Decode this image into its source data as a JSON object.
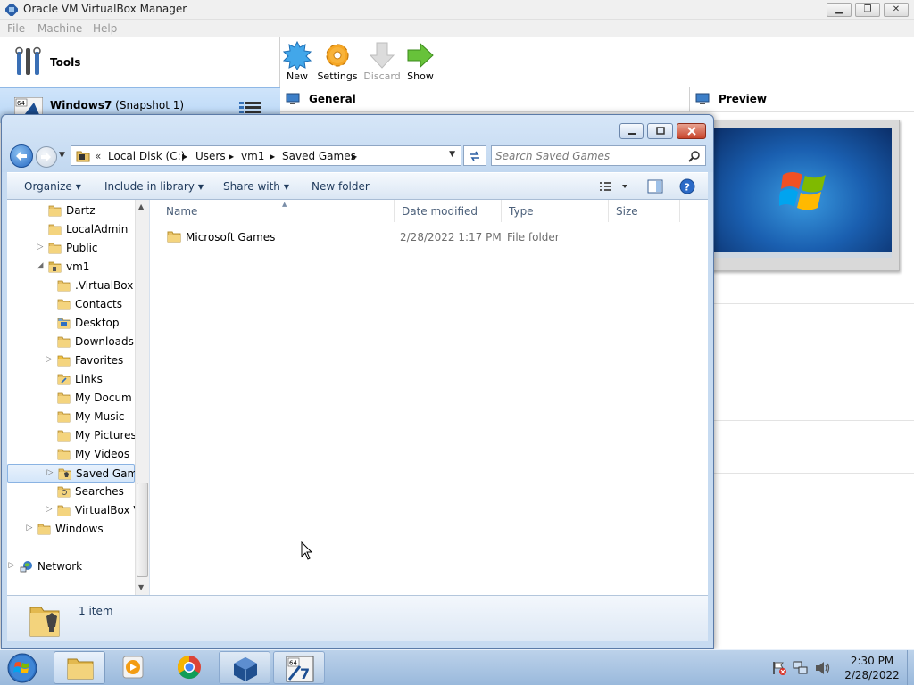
{
  "virtualbox": {
    "title": "Oracle VM VirtualBox Manager",
    "menu": [
      "File",
      "Machine",
      "Help"
    ],
    "tools_label": "Tools",
    "vm": {
      "name": "Windows7",
      "state": "(Snapshot 1)",
      "badge": "64"
    },
    "toolbar": {
      "new": "New",
      "settings": "Settings",
      "discard": "Discard",
      "show": "Show"
    },
    "sections": {
      "general": "General",
      "preview": "Preview"
    }
  },
  "explorer": {
    "breadcrumb": [
      "Local Disk (C:)",
      "Users",
      "vm1",
      "Saved Games"
    ],
    "breadcrumb_prefix": "«",
    "search_placeholder": "Search Saved Games",
    "commands": {
      "organize": "Organize",
      "include_in_library": "Include in library",
      "share_with": "Share with",
      "new_folder": "New folder"
    },
    "nav_tree": [
      {
        "label": "Dartz",
        "indent": 1,
        "arrow": "",
        "icon": "folder"
      },
      {
        "label": "LocalAdmin",
        "indent": 1,
        "arrow": "",
        "icon": "folder"
      },
      {
        "label": "Public",
        "indent": 1,
        "arrow": "collapsed",
        "icon": "folder"
      },
      {
        "label": "vm1",
        "indent": 1,
        "arrow": "expanded",
        "icon": "user-folder"
      },
      {
        "label": ".VirtualBox",
        "indent": 2,
        "arrow": "",
        "icon": "folder"
      },
      {
        "label": "Contacts",
        "indent": 2,
        "arrow": "",
        "icon": "contacts-folder"
      },
      {
        "label": "Desktop",
        "indent": 2,
        "arrow": "",
        "icon": "desktop-folder"
      },
      {
        "label": "Downloads",
        "indent": 2,
        "arrow": "",
        "icon": "downloads-folder"
      },
      {
        "label": "Favorites",
        "indent": 2,
        "arrow": "collapsed",
        "icon": "favorites-folder"
      },
      {
        "label": "Links",
        "indent": 2,
        "arrow": "",
        "icon": "links-folder"
      },
      {
        "label": "My Docum",
        "indent": 2,
        "arrow": "",
        "icon": "documents-folder"
      },
      {
        "label": "My Music",
        "indent": 2,
        "arrow": "",
        "icon": "music-folder"
      },
      {
        "label": "My Pictures",
        "indent": 2,
        "arrow": "",
        "icon": "pictures-folder"
      },
      {
        "label": "My Videos",
        "indent": 2,
        "arrow": "",
        "icon": "videos-folder"
      },
      {
        "label": "Saved Gam",
        "indent": 2,
        "arrow": "collapsed",
        "icon": "games-folder",
        "selected": true
      },
      {
        "label": "Searches",
        "indent": 2,
        "arrow": "",
        "icon": "searches-folder"
      },
      {
        "label": "VirtualBox V",
        "indent": 2,
        "arrow": "collapsed",
        "icon": "folder"
      },
      {
        "label": "Windows",
        "indent": 0,
        "arrow": "collapsed",
        "icon": "folder"
      },
      {
        "label": "",
        "indent": 0,
        "arrow": "",
        "icon": ""
      },
      {
        "label": "Network",
        "indent": -1,
        "arrow": "collapsed",
        "icon": "network"
      }
    ],
    "columns": {
      "name": "Name",
      "date_modified": "Date modified",
      "type": "Type",
      "size": "Size"
    },
    "files": [
      {
        "name": "Microsoft Games",
        "date_modified": "2/28/2022 1:17 PM",
        "type": "File folder",
        "size": ""
      }
    ],
    "status": "1 item"
  },
  "taskbar": {
    "time": "2:30 PM",
    "date": "2/28/2022"
  },
  "colors": {
    "explorer_frame": "#c7dbf1",
    "selection": "#cce4fb",
    "taskbar": "#a9c4e3",
    "show_green": "#5cb82e",
    "new_blue": "#3aa0e8",
    "settings_orange": "#f5a623"
  }
}
